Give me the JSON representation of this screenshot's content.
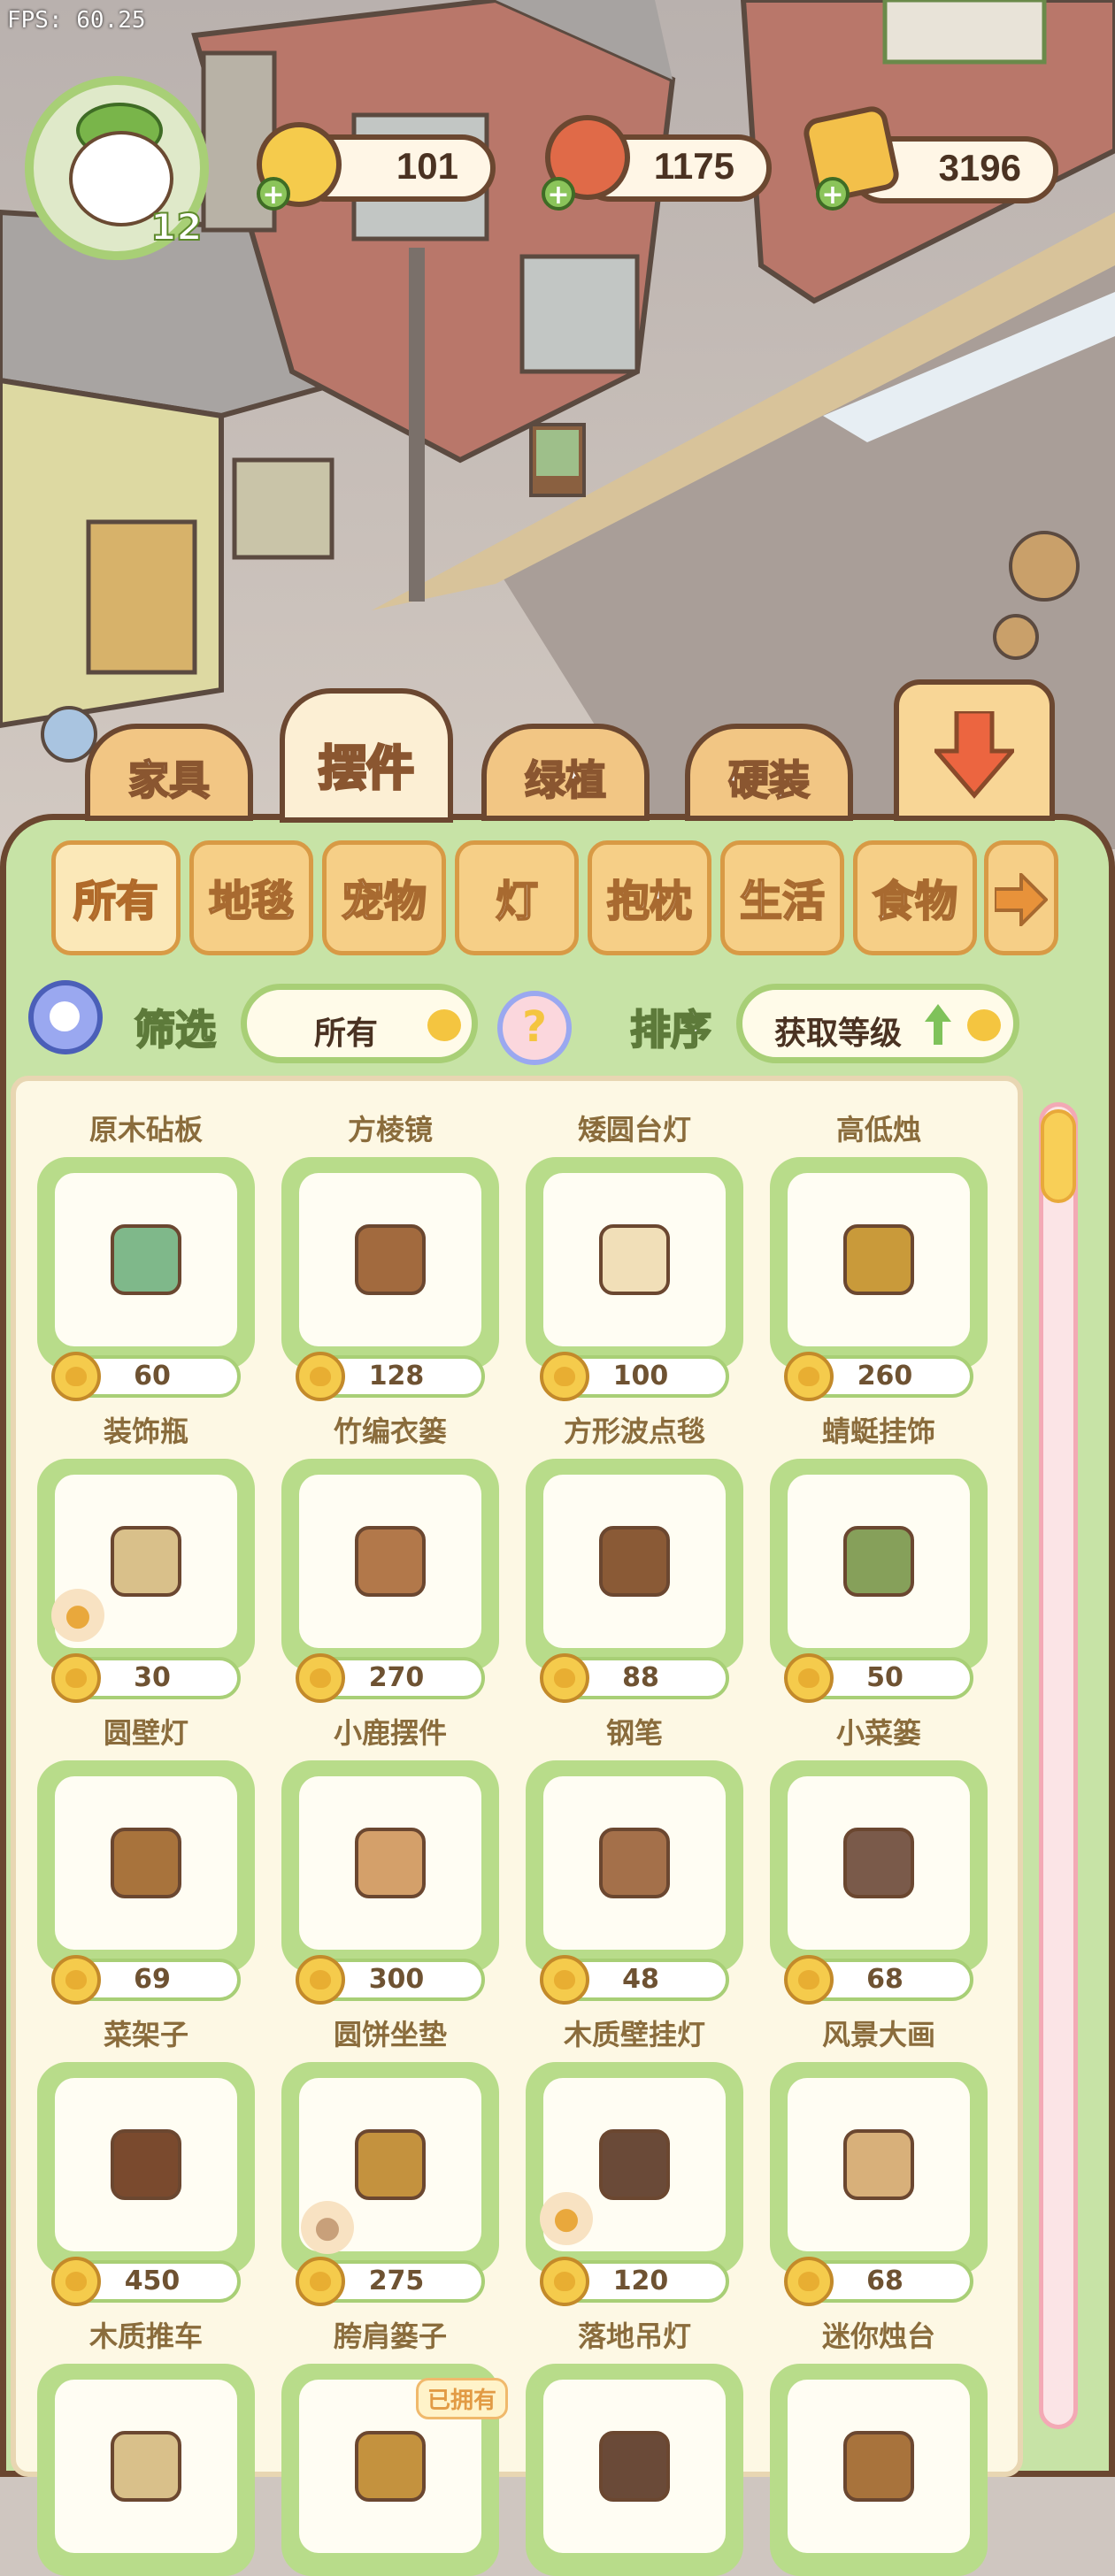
{
  "fps": "FPS: 60.25",
  "player": {
    "level": "12"
  },
  "resources": {
    "coins": "101",
    "food": "1175",
    "tickets": "3196",
    "add_symbol": "+"
  },
  "colors": {
    "accent_green": "#a8cf76",
    "panel_bg": "#c7e3a6",
    "border_brown": "#6b4730",
    "tab_orange": "#f2c684",
    "coin_yellow": "#f5cb4c",
    "scroll_pink": "#f3a9b5"
  },
  "tabs": [
    {
      "label": "家具"
    },
    {
      "label": "摆件"
    },
    {
      "label": "绿植"
    },
    {
      "label": "硬装"
    }
  ],
  "collapse_icon": "arrow-down-icon",
  "categories": [
    {
      "label": "所有"
    },
    {
      "label": "地毯"
    },
    {
      "label": "宠物"
    },
    {
      "label": "灯"
    },
    {
      "label": "抱枕"
    },
    {
      "label": "生活"
    },
    {
      "label": "食物"
    }
  ],
  "next_category_icon": "arrow-right-icon",
  "filter": {
    "label": "筛选",
    "value": "所有",
    "help_icon": "question-icon"
  },
  "sort": {
    "label": "排序",
    "value": "获取等级",
    "direction_icon": "arrow-up-icon"
  },
  "rows": [
    {
      "names": [
        "原木砧板",
        "方棱镜",
        "矮圆台灯",
        "高低烛"
      ],
      "prices": [
        "60",
        "128",
        "100",
        "260"
      ]
    },
    {
      "names": [
        "装饰瓶",
        "竹编衣篓",
        "方形波点毯",
        "蜻蜓挂饰"
      ],
      "prices": [
        "30",
        "270",
        "88",
        "50"
      ]
    },
    {
      "names": [
        "圆壁灯",
        "小鹿摆件",
        "钢笔",
        "小菜篓"
      ],
      "prices": [
        "69",
        "300",
        "48",
        "68"
      ]
    },
    {
      "names": [
        "菜架子",
        "圆饼坐垫",
        "木质壁挂灯",
        "风景大画"
      ],
      "prices": [
        "450",
        "275",
        "120",
        "68"
      ]
    },
    {
      "names": [
        "木质推车",
        "胯肩篓子",
        "落地吊灯",
        "迷你烛台"
      ],
      "prices": []
    }
  ],
  "owned_badge": "已拥有"
}
